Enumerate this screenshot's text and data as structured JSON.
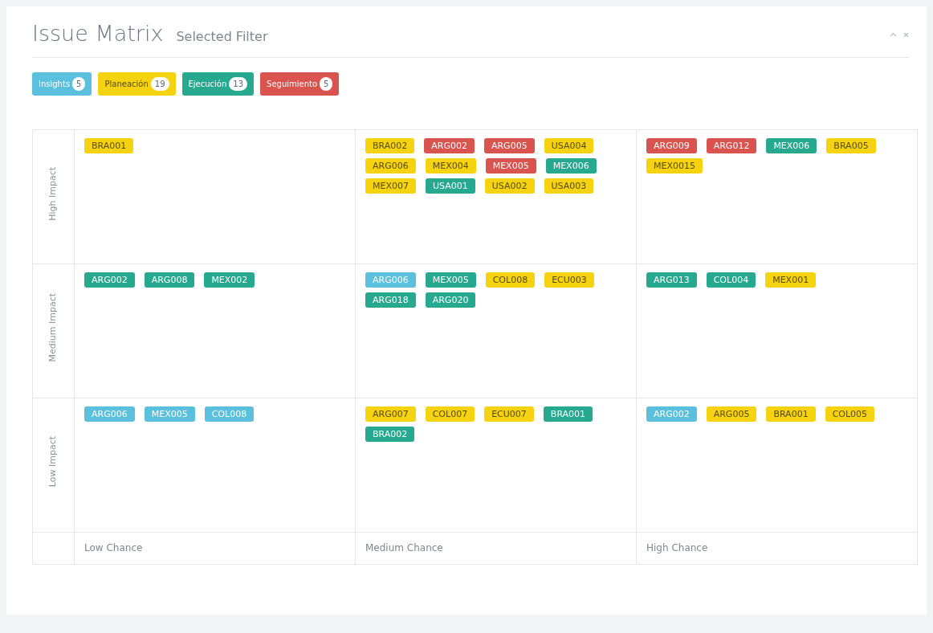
{
  "header": {
    "title": "Issue Matrix",
    "subtitle": "Selected Filter"
  },
  "legend": [
    {
      "label": "Insights",
      "count": "5",
      "color": "#5bc0de"
    },
    {
      "label": "Planeación",
      "count": "19",
      "color": "#f5d311"
    },
    {
      "label": "Ejecución",
      "count": "13",
      "color": "#26a98f"
    },
    {
      "label": "Seguimiento",
      "count": "5",
      "color": "#d9534f"
    }
  ],
  "matrix": {
    "rows": [
      {
        "label": "High Impact",
        "cells": [
          {
            "tags": [
              {
                "code": "BRA001",
                "color": "#f5d311"
              }
            ]
          },
          {
            "tags": [
              {
                "code": "BRA002",
                "color": "#f5d311"
              },
              {
                "code": "ARG002",
                "color": "#d9534f"
              },
              {
                "code": "ARG005",
                "color": "#d9534f"
              },
              {
                "code": "USA004",
                "color": "#f5d311"
              },
              {
                "code": "ARG006",
                "color": "#f5d311"
              },
              {
                "code": "MEX004",
                "color": "#f5d311"
              },
              {
                "code": "MEX005",
                "color": "#d9534f"
              },
              {
                "code": "MEX006",
                "color": "#26a98f"
              },
              {
                "code": "MEX007",
                "color": "#f5d311"
              },
              {
                "code": "USA001",
                "color": "#26a98f"
              },
              {
                "code": "USA002",
                "color": "#f5d311"
              },
              {
                "code": "USA003",
                "color": "#f5d311"
              }
            ]
          },
          {
            "tags": [
              {
                "code": "ARG009",
                "color": "#d9534f"
              },
              {
                "code": "ARG012",
                "color": "#d9534f"
              },
              {
                "code": "MEX006",
                "color": "#26a98f"
              },
              {
                "code": "BRA005",
                "color": "#f5d311"
              },
              {
                "code": "MEX0015",
                "color": "#f5d311"
              }
            ]
          }
        ]
      },
      {
        "label": "Medium Impact",
        "cells": [
          {
            "tags": [
              {
                "code": "ARG002",
                "color": "#26a98f"
              },
              {
                "code": "ARG008",
                "color": "#26a98f"
              },
              {
                "code": "MEX002",
                "color": "#26a98f"
              }
            ]
          },
          {
            "tags": [
              {
                "code": "ARG006",
                "color": "#5bc0de"
              },
              {
                "code": "MEX005",
                "color": "#26a98f"
              },
              {
                "code": "COL008",
                "color": "#f5d311"
              },
              {
                "code": "ECU003",
                "color": "#f5d311"
              },
              {
                "code": "ARG018",
                "color": "#26a98f"
              },
              {
                "code": "ARG020",
                "color": "#26a98f"
              }
            ]
          },
          {
            "tags": [
              {
                "code": "ARG013",
                "color": "#26a98f"
              },
              {
                "code": "COL004",
                "color": "#26a98f"
              },
              {
                "code": "MEX001",
                "color": "#f5d311"
              }
            ]
          }
        ]
      },
      {
        "label": "Low Impact",
        "cells": [
          {
            "tags": [
              {
                "code": "ARG006",
                "color": "#5bc0de"
              },
              {
                "code": "MEX005",
                "color": "#5bc0de"
              },
              {
                "code": "COL008",
                "color": "#5bc0de"
              }
            ]
          },
          {
            "tags": [
              {
                "code": "ARG007",
                "color": "#f5d311"
              },
              {
                "code": "COL007",
                "color": "#f5d311"
              },
              {
                "code": "ECU007",
                "color": "#f5d311"
              },
              {
                "code": "BRA001",
                "color": "#26a98f"
              },
              {
                "code": "BRA002",
                "color": "#26a98f"
              }
            ]
          },
          {
            "tags": [
              {
                "code": "ARG002",
                "color": "#5bc0de"
              },
              {
                "code": "ARG005",
                "color": "#f5d311"
              },
              {
                "code": "BRA001",
                "color": "#f5d311"
              },
              {
                "code": "COL005",
                "color": "#f5d311"
              }
            ]
          }
        ]
      }
    ],
    "footer_labels": [
      "Low Chance",
      "Medium Chance",
      "High Chance"
    ]
  }
}
